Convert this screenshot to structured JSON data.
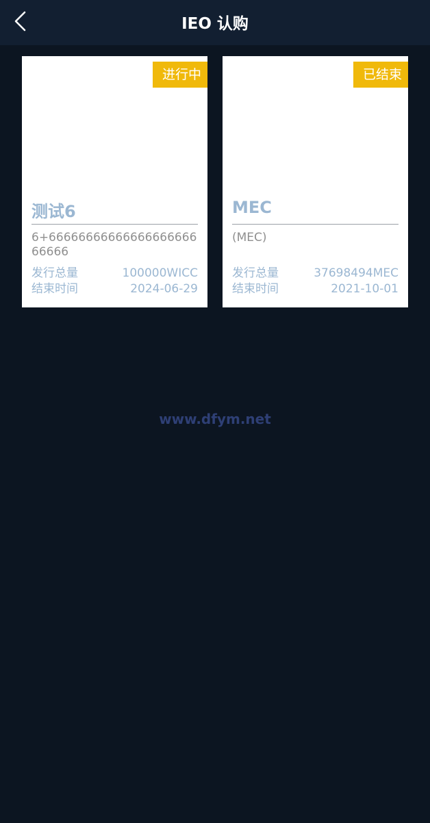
{
  "header": {
    "title": "IEO 认购",
    "back_icon": "chevron-left-icon"
  },
  "cards": [
    {
      "status": "进行中",
      "status_color": "#f0b90b",
      "name": "测试6",
      "description": "6+6666666666666666666666666",
      "issue_label": "发行总量",
      "issue_value": "100000WICC",
      "end_label": "结束时间",
      "end_value": "2024-06-29"
    },
    {
      "status": "已结束",
      "status_color": "#f0b90b",
      "name": "MEC",
      "description": "(MEC)",
      "issue_label": "发行总量",
      "issue_value": "37698494MEC",
      "end_label": "结束时间",
      "end_value": "2021-10-01"
    }
  ],
  "watermark": "www.dfym.net",
  "colors": {
    "background": "#0c1521",
    "header": "#121f31",
    "accent": "#f0b90b",
    "card_text": "#9bb7d2",
    "watermark": "#2e3f75"
  }
}
